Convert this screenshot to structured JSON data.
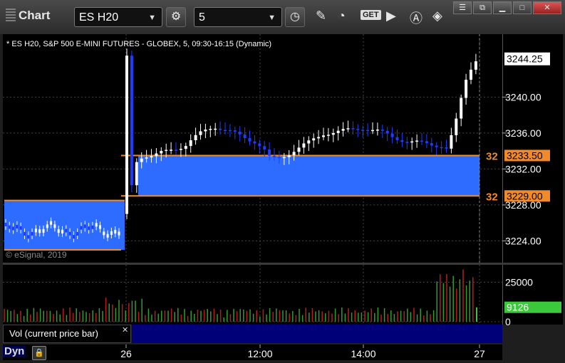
{
  "app": {
    "title": "Chart"
  },
  "toolbar": {
    "symbol": "ES H20",
    "interval": "5",
    "get_label": "GET"
  },
  "chart": {
    "subtitle": "* ES H20, S&P 500 E-MINI FUTURES - GLOBEX, 5, 09:30-16:15 (Dynamic)",
    "copyright": "© eSignal, 2019",
    "last_price_label": "3244.25",
    "upper_level_label": "3233.50",
    "lower_level_label": "3229.00",
    "level_prefix": "32"
  },
  "volume": {
    "study_label": "Vol (current price bar)",
    "current_value_label": "9126"
  },
  "status": {
    "mode": "Dyn"
  },
  "colors": {
    "zone_blue": "#2e6bff",
    "level_orange": "#f28a2a",
    "up_bar": "#ffffff",
    "down_bar": "#1e3cff",
    "vol_up": "#2e9e2e",
    "vol_down": "#b81d1d",
    "vol_last": "#3bc83b"
  },
  "chart_data": {
    "type": "candlestick",
    "price_ticks": [
      3224,
      3228,
      3232,
      3236,
      3240
    ],
    "price_tick_labels": [
      "3224.00",
      "3228.00",
      "3232.00",
      "3236.00",
      "3240.00"
    ],
    "ylim": [
      3221.5,
      3247
    ],
    "time_ticks": [
      "26",
      "12:00",
      "14:00",
      "27"
    ],
    "zones": [
      {
        "from_time": "prior session",
        "to_time": "26",
        "low": 3223.0,
        "high": 3228.5
      },
      {
        "from_time": "26",
        "to_time": "27",
        "low": 3229.0,
        "high": 3233.5
      }
    ],
    "volume_ticks": [
      0,
      25000
    ],
    "volume_tick_labels": [
      "0",
      "25000"
    ],
    "volume_ylim": [
      0,
      36000
    ],
    "last_volume": 9126
  }
}
